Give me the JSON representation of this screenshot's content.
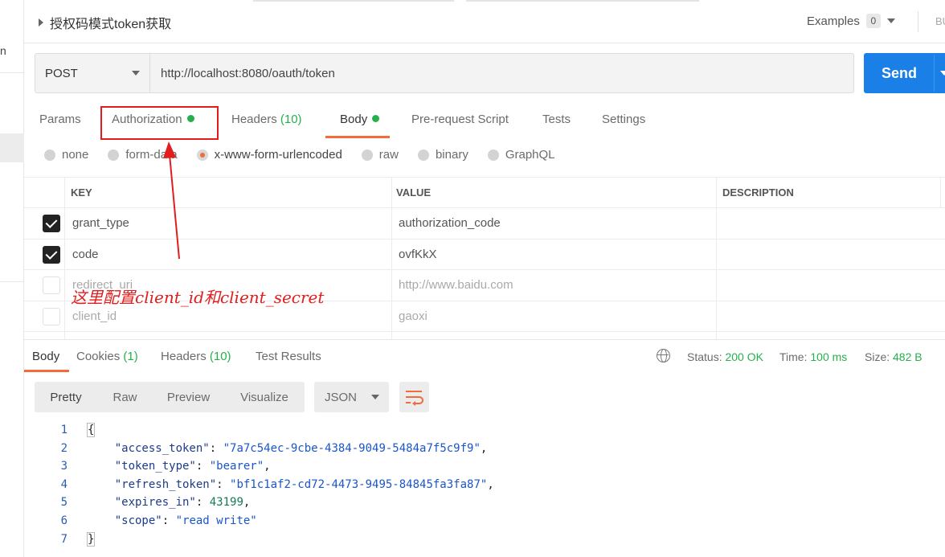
{
  "header": {
    "title": "授权码模式token获取",
    "examples_label": "Examples",
    "examples_count": "0",
    "right_fragment": "BU",
    "left_fragment": "n"
  },
  "request": {
    "method": "POST",
    "url": "http://localhost:8080/oauth/token",
    "send_label": "Send"
  },
  "tabs": [
    {
      "label": "Params"
    },
    {
      "label": "Authorization"
    },
    {
      "label": "Headers",
      "count": "(10)"
    },
    {
      "label": "Body"
    },
    {
      "label": "Pre-request Script"
    },
    {
      "label": "Tests"
    },
    {
      "label": "Settings"
    }
  ],
  "body_types": [
    "none",
    "form-data",
    "x-www-form-urlencoded",
    "raw",
    "binary",
    "GraphQL"
  ],
  "params_table": {
    "headers": [
      "KEY",
      "VALUE",
      "DESCRIPTION"
    ],
    "rows": [
      {
        "key": "grant_type",
        "value": "authorization_code",
        "checked": true
      },
      {
        "key": "code",
        "value": "ovfKkX",
        "checked": true
      },
      {
        "key": "redirect_uri",
        "value": "http://www.baidu.com",
        "checked": false
      },
      {
        "key": "client_id",
        "value": "gaoxi",
        "checked": false
      }
    ]
  },
  "annotation": "这里配置client_id和client_secret",
  "response": {
    "tabs": [
      {
        "label": "Body"
      },
      {
        "label": "Cookies",
        "count": "(1)"
      },
      {
        "label": "Headers",
        "count": "(10)"
      },
      {
        "label": "Test Results"
      }
    ],
    "status_label": "Status:",
    "status_value": "200 OK",
    "time_label": "Time:",
    "time_value": "100 ms",
    "size_label": "Size:",
    "size_value": "482 B",
    "view_modes": [
      "Pretty",
      "Raw",
      "Preview",
      "Visualize"
    ],
    "format": "JSON",
    "code_lines": [
      {
        "n": "1",
        "open": "{"
      },
      {
        "n": "2",
        "key": "\"access_token\"",
        "val": "\"7a7c54ec-9cbe-4384-9049-5484a7f5c9f9\"",
        "trail": ","
      },
      {
        "n": "3",
        "key": "\"token_type\"",
        "val": "\"bearer\"",
        "trail": ","
      },
      {
        "n": "4",
        "key": "\"refresh_token\"",
        "val": "\"bf1c1af2-cd72-4473-9495-84845fa3fa87\"",
        "trail": ","
      },
      {
        "n": "5",
        "key": "\"expires_in\"",
        "num": "43199",
        "trail": ","
      },
      {
        "n": "6",
        "key": "\"scope\"",
        "val": "\"read write\"",
        "trail": ""
      },
      {
        "n": "7",
        "close": "}"
      }
    ]
  },
  "colors": {
    "accent": "#f26b3a",
    "send": "#1a7fe6",
    "success": "#26b04b",
    "annotation": "#e31d1d"
  }
}
